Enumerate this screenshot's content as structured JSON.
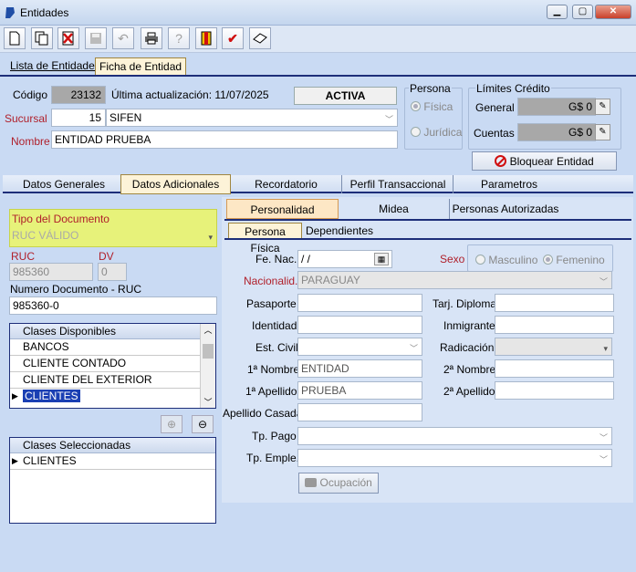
{
  "window": {
    "title": "Entidades",
    "min": "▁",
    "max": "▢",
    "close": "✕"
  },
  "toolbar": {
    "new_icon": "document-icon",
    "copy_icon": "copy-icon",
    "delete_icon": "delete-icon",
    "save_icon": "save-icon",
    "undo_icon": "undo-icon",
    "print_icon": "print-icon",
    "help_icon": "help-icon",
    "exit_icon": "exit-icon",
    "check_icon": "check-icon",
    "eraser_icon": "eraser-icon"
  },
  "main_tabs": [
    {
      "label": "Lista de Entidades"
    },
    {
      "label": "Ficha de Entidad"
    }
  ],
  "header": {
    "codigo_label": "Código",
    "codigo_value": "23132",
    "ultima_label": "Última actualización: 11/07/2025",
    "status": "ACTIVA",
    "sucursal_label": "Sucursal",
    "sucursal_num": "15",
    "sucursal_name": "SIFEN",
    "nombre_label": "Nombre",
    "nombre_value": "ENTIDAD PRUEBA",
    "persona_label": "Persona",
    "fisica": "Física",
    "juridica": "Jurídica",
    "limites_label": "Límites Crédito",
    "general_label": "General",
    "general_value": "G$ 0",
    "cuentas_label": "Cuentas",
    "cuentas_value": "G$ 0",
    "bloquear": "Bloquear Entidad"
  },
  "section_tabs": [
    {
      "label": "Datos Generales"
    },
    {
      "label": "Datos Adicionales"
    },
    {
      "label": "Recordatorio"
    },
    {
      "label": "Perfil Transaccional"
    },
    {
      "label": "Parametros Comerciales"
    }
  ],
  "left": {
    "tipo_doc_label": "Tipo del Documento",
    "tipo_doc_value": "RUC VÁLIDO",
    "ruc_label": "RUC",
    "ruc_value": "985360",
    "dv_label": "DV",
    "dv_value": "0",
    "numdoc_label": "Numero Documento - RUC",
    "numdoc_value": "985360-0",
    "disponibles_header": "Clases Disponibles",
    "disponibles": [
      "BANCOS",
      "CLIENTE CONTADO",
      "CLIENTE DEL EXTERIOR",
      "CLIENTES"
    ],
    "seleccionadas_header": "Clases Seleccionadas",
    "seleccionadas": [
      "CLIENTES"
    ]
  },
  "panel_tabs": [
    {
      "label": "Personalidad"
    },
    {
      "label": "Midea"
    },
    {
      "label": "Personas Autorizadas"
    }
  ],
  "sub_tabs": [
    {
      "label": "Persona Física"
    },
    {
      "label": "Dependientes"
    }
  ],
  "persona": {
    "fenac_label": "Fe. Nac.",
    "fenac_value": " /  /",
    "sexo_label": "Sexo",
    "masculino": "Masculino",
    "femenino": "Femenino",
    "nacionalidad_label": "Nacionalid.",
    "nacionalidad_value": "PARAGUAY",
    "pasaporte_label": "Pasaporte",
    "tarj_label": "Tarj. Diploma",
    "identidad_label": "Identidad",
    "inmigrante_label": "Inmigrante",
    "estcivil_label": "Est. Civil",
    "radicacion_label": "Radicación",
    "nombre1_label": "1ª Nombre",
    "nombre1_value": "ENTIDAD",
    "nombre2_label": "2ª Nombre",
    "apellido1_label": "1ª Apellido",
    "apellido1_value": "PRUEBA",
    "apellido2_label": "2ª Apellido",
    "casada_label": "Apellido Casada",
    "tppago_label": "Tp. Pago",
    "tpemple_label": "Tp. Emple.",
    "ocupacion": "Ocupación"
  }
}
